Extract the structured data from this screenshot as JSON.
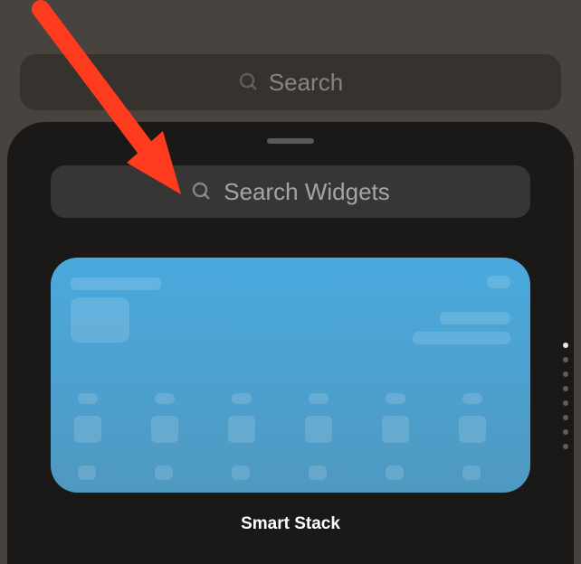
{
  "colors": {
    "accent_arrow": "#ff3b1f",
    "widget_gradient_top": "#4aa9de",
    "widget_gradient_bottom": "#4f99c1"
  },
  "background_search": {
    "placeholder": "Search"
  },
  "sheet": {
    "search_placeholder": "Search Widgets",
    "widget": {
      "title": "Smart Stack"
    },
    "page_indicator": {
      "count": 8,
      "active_index": 0
    }
  }
}
